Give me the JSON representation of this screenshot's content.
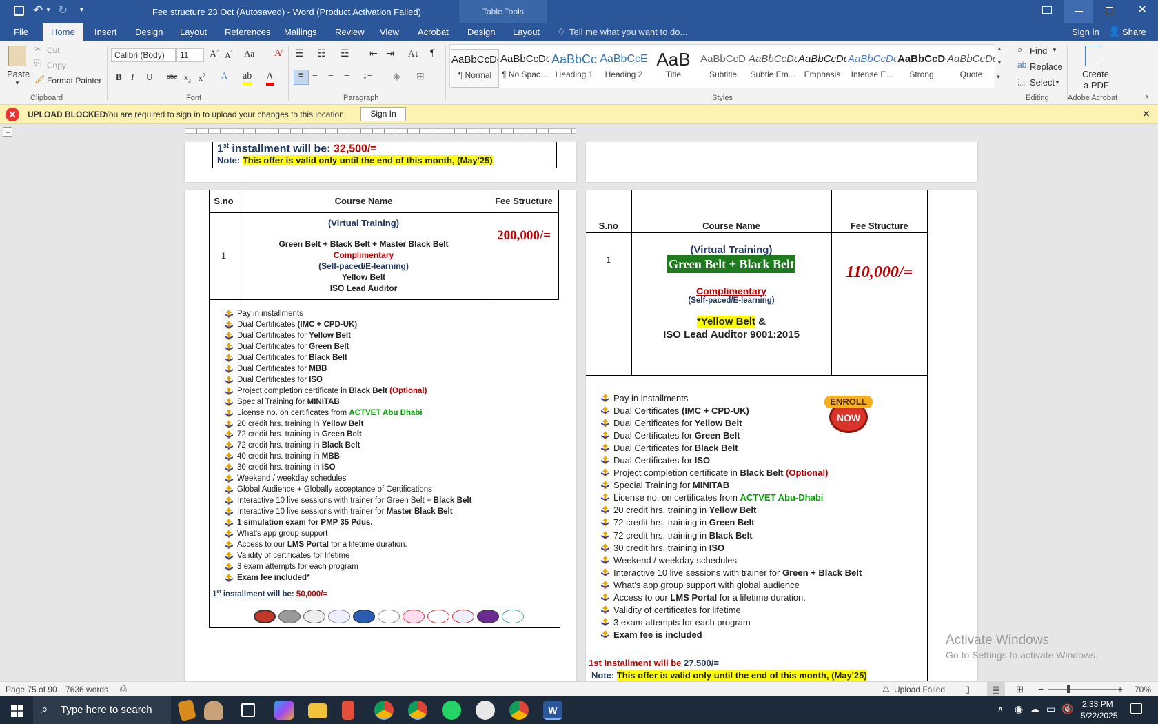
{
  "titlebar": {
    "title": "Fee structure 23 Oct (Autosaved) - Word (Product Activation Failed)",
    "context_tab": "Table Tools"
  },
  "tabs": [
    "File",
    "Home",
    "Insert",
    "Design",
    "Layout",
    "References",
    "Mailings",
    "Review",
    "View",
    "Acrobat",
    "Design",
    "Layout"
  ],
  "tell_me": "Tell me what you want to do...",
  "account": {
    "signin": "Sign in",
    "share": "Share"
  },
  "ribbon": {
    "clipboard": {
      "paste": "Paste",
      "cut": "Cut",
      "copy": "Copy",
      "format_painter": "Format Painter",
      "label": "Clipboard"
    },
    "font": {
      "name": "Calibri (Body)",
      "size": "11",
      "label": "Font"
    },
    "paragraph": {
      "label": "Paragraph"
    },
    "styles": {
      "label": "Styles",
      "items": [
        {
          "preview": "AaBbCcDc",
          "name": "¶ Normal"
        },
        {
          "preview": "AaBbCcDc",
          "name": "¶ No Spac..."
        },
        {
          "preview": "AaBbCc",
          "name": "Heading 1"
        },
        {
          "preview": "AaBbCcE",
          "name": "Heading 2"
        },
        {
          "preview": "AaB",
          "name": "Title"
        },
        {
          "preview": "AaBbCcD",
          "name": "Subtitle"
        },
        {
          "preview": "AaBbCcDc",
          "name": "Subtle Em..."
        },
        {
          "preview": "AaBbCcDc",
          "name": "Emphasis"
        },
        {
          "preview": "AaBbCcDc",
          "name": "Intense E..."
        },
        {
          "preview": "AaBbCcDc",
          "name": "Strong"
        },
        {
          "preview": "AaBbCcDc",
          "name": "Quote"
        }
      ]
    },
    "editing": {
      "find": "Find",
      "replace": "Replace",
      "select": "Select",
      "label": "Editing"
    },
    "acrobat": {
      "create_line1": "Create",
      "create_line2": "a PDF",
      "label": "Adobe Acrobat"
    }
  },
  "message": {
    "title": "UPLOAD BLOCKED",
    "text": "You are required to sign in to upload your changes to this location.",
    "button": "Sign In"
  },
  "doc": {
    "top_left": {
      "installment_prefix": "1",
      "installment_sup": "st",
      "installment_text": " installment will be: ",
      "installment_value": "32,500/=",
      "note_label": "Note: ",
      "note_text": "This offer is valid only until the end of this month, (May'25)"
    },
    "left": {
      "h_sno": "S.no",
      "h_course": "Course Name",
      "h_fee": "Fee Structure",
      "sno": "1",
      "virtual": "(Virtual Training)",
      "belts": "Green Belt + Black Belt + Master Black Belt",
      "complimentary": "Complimentary",
      "selfpaced": "(Self-paced/E-learning)",
      "yellow": "Yellow Belt",
      "iso": "ISO Lead Auditor",
      "fee": "200,000/=",
      "features": [
        {
          "t": "Pay in installments",
          "b": "",
          "x": ""
        },
        {
          "t": "Dual Certificates ",
          "b": "(IMC + CPD-UK)",
          "x": ""
        },
        {
          "t": "Dual Certificates for ",
          "b": "Yellow Belt",
          "x": ""
        },
        {
          "t": "Dual Certificates for ",
          "b": "Green Belt",
          "x": ""
        },
        {
          "t": "Dual Certificates for ",
          "b": "Black Belt",
          "x": ""
        },
        {
          "t": " Dual Certificates for ",
          "b": "MBB",
          "x": ""
        },
        {
          "t": "Dual Certificates for ",
          "b": "ISO",
          "x": ""
        },
        {
          "t": "Project completion certificate in ",
          "b": "Black Belt",
          "x": " (Optional)"
        },
        {
          "t": "Special Training for ",
          "b": "MINITAB",
          "x": ""
        },
        {
          "t": "License no. on certificates from ",
          "b": "",
          "g": "ACTVET Abu Dhabi"
        },
        {
          "t": "20 credit hrs. training in ",
          "b": "Yellow Belt",
          "x": ""
        },
        {
          "t": "72 credit hrs. training in ",
          "b": "Green Belt",
          "x": ""
        },
        {
          "t": "72 credit hrs. training in ",
          "b": "Black Belt",
          "x": ""
        },
        {
          "t": "40 credit hrs. training in ",
          "b": "MBB",
          "x": ""
        },
        {
          "t": " 30 credit hrs. training in ",
          "b": "ISO",
          "x": ""
        },
        {
          "t": " Weekend / weekday schedules",
          "b": "",
          "x": ""
        },
        {
          "t": "Global Audience + Globally acceptance of Certifications",
          "b": "",
          "x": ""
        },
        {
          "t": "Interactive 10 live sessions with trainer for Green Belt +  ",
          "b": "Black Belt",
          "x": ""
        },
        {
          "t": "Interactive 10 live sessions with trainer for ",
          "b": "Master Black Belt",
          "x": ""
        },
        {
          "t": "",
          "b": "1 simulation exam for PMP 35 Pdus.",
          "x": ""
        },
        {
          "t": "What's app group support",
          "b": "",
          "x": ""
        },
        {
          "t": "Access to our ",
          "b": "LMS Portal",
          "x": "",
          "after": " for a lifetime duration."
        },
        {
          "t": "Validity of certificates for lifetime",
          "b": "",
          "x": ""
        },
        {
          "t": "3 exam attempts for each program",
          "b": "",
          "x": ""
        },
        {
          "t": "",
          "b": "Exam fee included*",
          "x": ""
        }
      ],
      "inst_prefix": "1",
      "inst_sup": "st",
      "inst_text": " installment will be: ",
      "inst_value": "50,000/="
    },
    "right": {
      "h_sno": "S.no",
      "h_course": "Course Name",
      "h_fee": "Fee Structure",
      "sno": "1",
      "virtual": "(Virtual Training)",
      "belts": "Green Belt + Black Belt",
      "complimentary": "Complimentary",
      "selfpaced": "(Self-paced/E-learning)",
      "yellow": "*Yellow Belt",
      "amp": " &",
      "iso": "ISO Lead Auditor 9001:2015",
      "fee": "110,000/=",
      "enroll1": "ENROLL",
      "enroll2": "NOW",
      "features": [
        {
          "t": "Pay in installments",
          "b": "",
          "x": ""
        },
        {
          "t": "Dual Certificates ",
          "b": "(IMC + CPD-UK)",
          "x": ""
        },
        {
          "t": "Dual Certificates for ",
          "b": "Yellow Belt",
          "x": ""
        },
        {
          "t": "Dual Certificates for ",
          "b": "Green Belt",
          "x": ""
        },
        {
          "t": "Dual Certificates for ",
          "b": "Black Belt",
          "x": ""
        },
        {
          "t": "Dual Certificates for ",
          "b": "ISO",
          "x": ""
        },
        {
          "t": " Project completion certificate in ",
          "b": "Black Belt",
          "x": " (Optional)"
        },
        {
          "t": "Special Training for ",
          "b": "MINITAB",
          "x": ""
        },
        {
          "t": "License no. on certificates from ",
          "b": "",
          "g": "ACTVET Abu-Dhabi"
        },
        {
          "t": "20 credit hrs. training in ",
          "b": "Yellow Belt",
          "x": ""
        },
        {
          "t": "72 credit hrs. training in ",
          "b": "Green Belt",
          "x": ""
        },
        {
          "t": "72 credit hrs. training in ",
          "b": "Black Belt",
          "x": ""
        },
        {
          "t": "30 credit hrs. training in ",
          "b": "ISO",
          "x": ""
        },
        {
          "t": " Weekend / weekday schedules",
          "b": "",
          "x": ""
        },
        {
          "t": "Interactive 10 live sessions with trainer for ",
          "b": "Green + Black Belt",
          "x": ""
        },
        {
          "t": "What's app group support with global audience",
          "b": "",
          "x": ""
        },
        {
          "t": "Access to our ",
          "b": "LMS Portal",
          "x": "",
          "after": " for a lifetime duration."
        },
        {
          "t": "Validity of certificates for lifetime",
          "b": "",
          "x": ""
        },
        {
          "t": "3 exam attempts for each program",
          "b": "",
          "x": ""
        },
        {
          "t": "",
          "b": "Exam fee is included",
          "x": ""
        }
      ],
      "inst_text": "1st Installment will be ",
      "inst_value": "27,500/=",
      "note_label": "Note: ",
      "note_text": "This offer is valid only until the end of this month, (May'25)"
    }
  },
  "watermark": {
    "line1": "Activate Windows",
    "line2": "Go to Settings to activate Windows."
  },
  "status": {
    "page": "Page 75 of 90",
    "words": "7636 words",
    "upload": "Upload Failed",
    "zoom": "70%"
  },
  "taskbar": {
    "search": "Type here to search",
    "time": "2:33 PM",
    "date": "5/22/2025"
  },
  "colors": {
    "word_blue": "#2b579a",
    "accent_red": "#c00000",
    "highlight": "#ffff00",
    "green_fill": "#1e7b1e"
  }
}
